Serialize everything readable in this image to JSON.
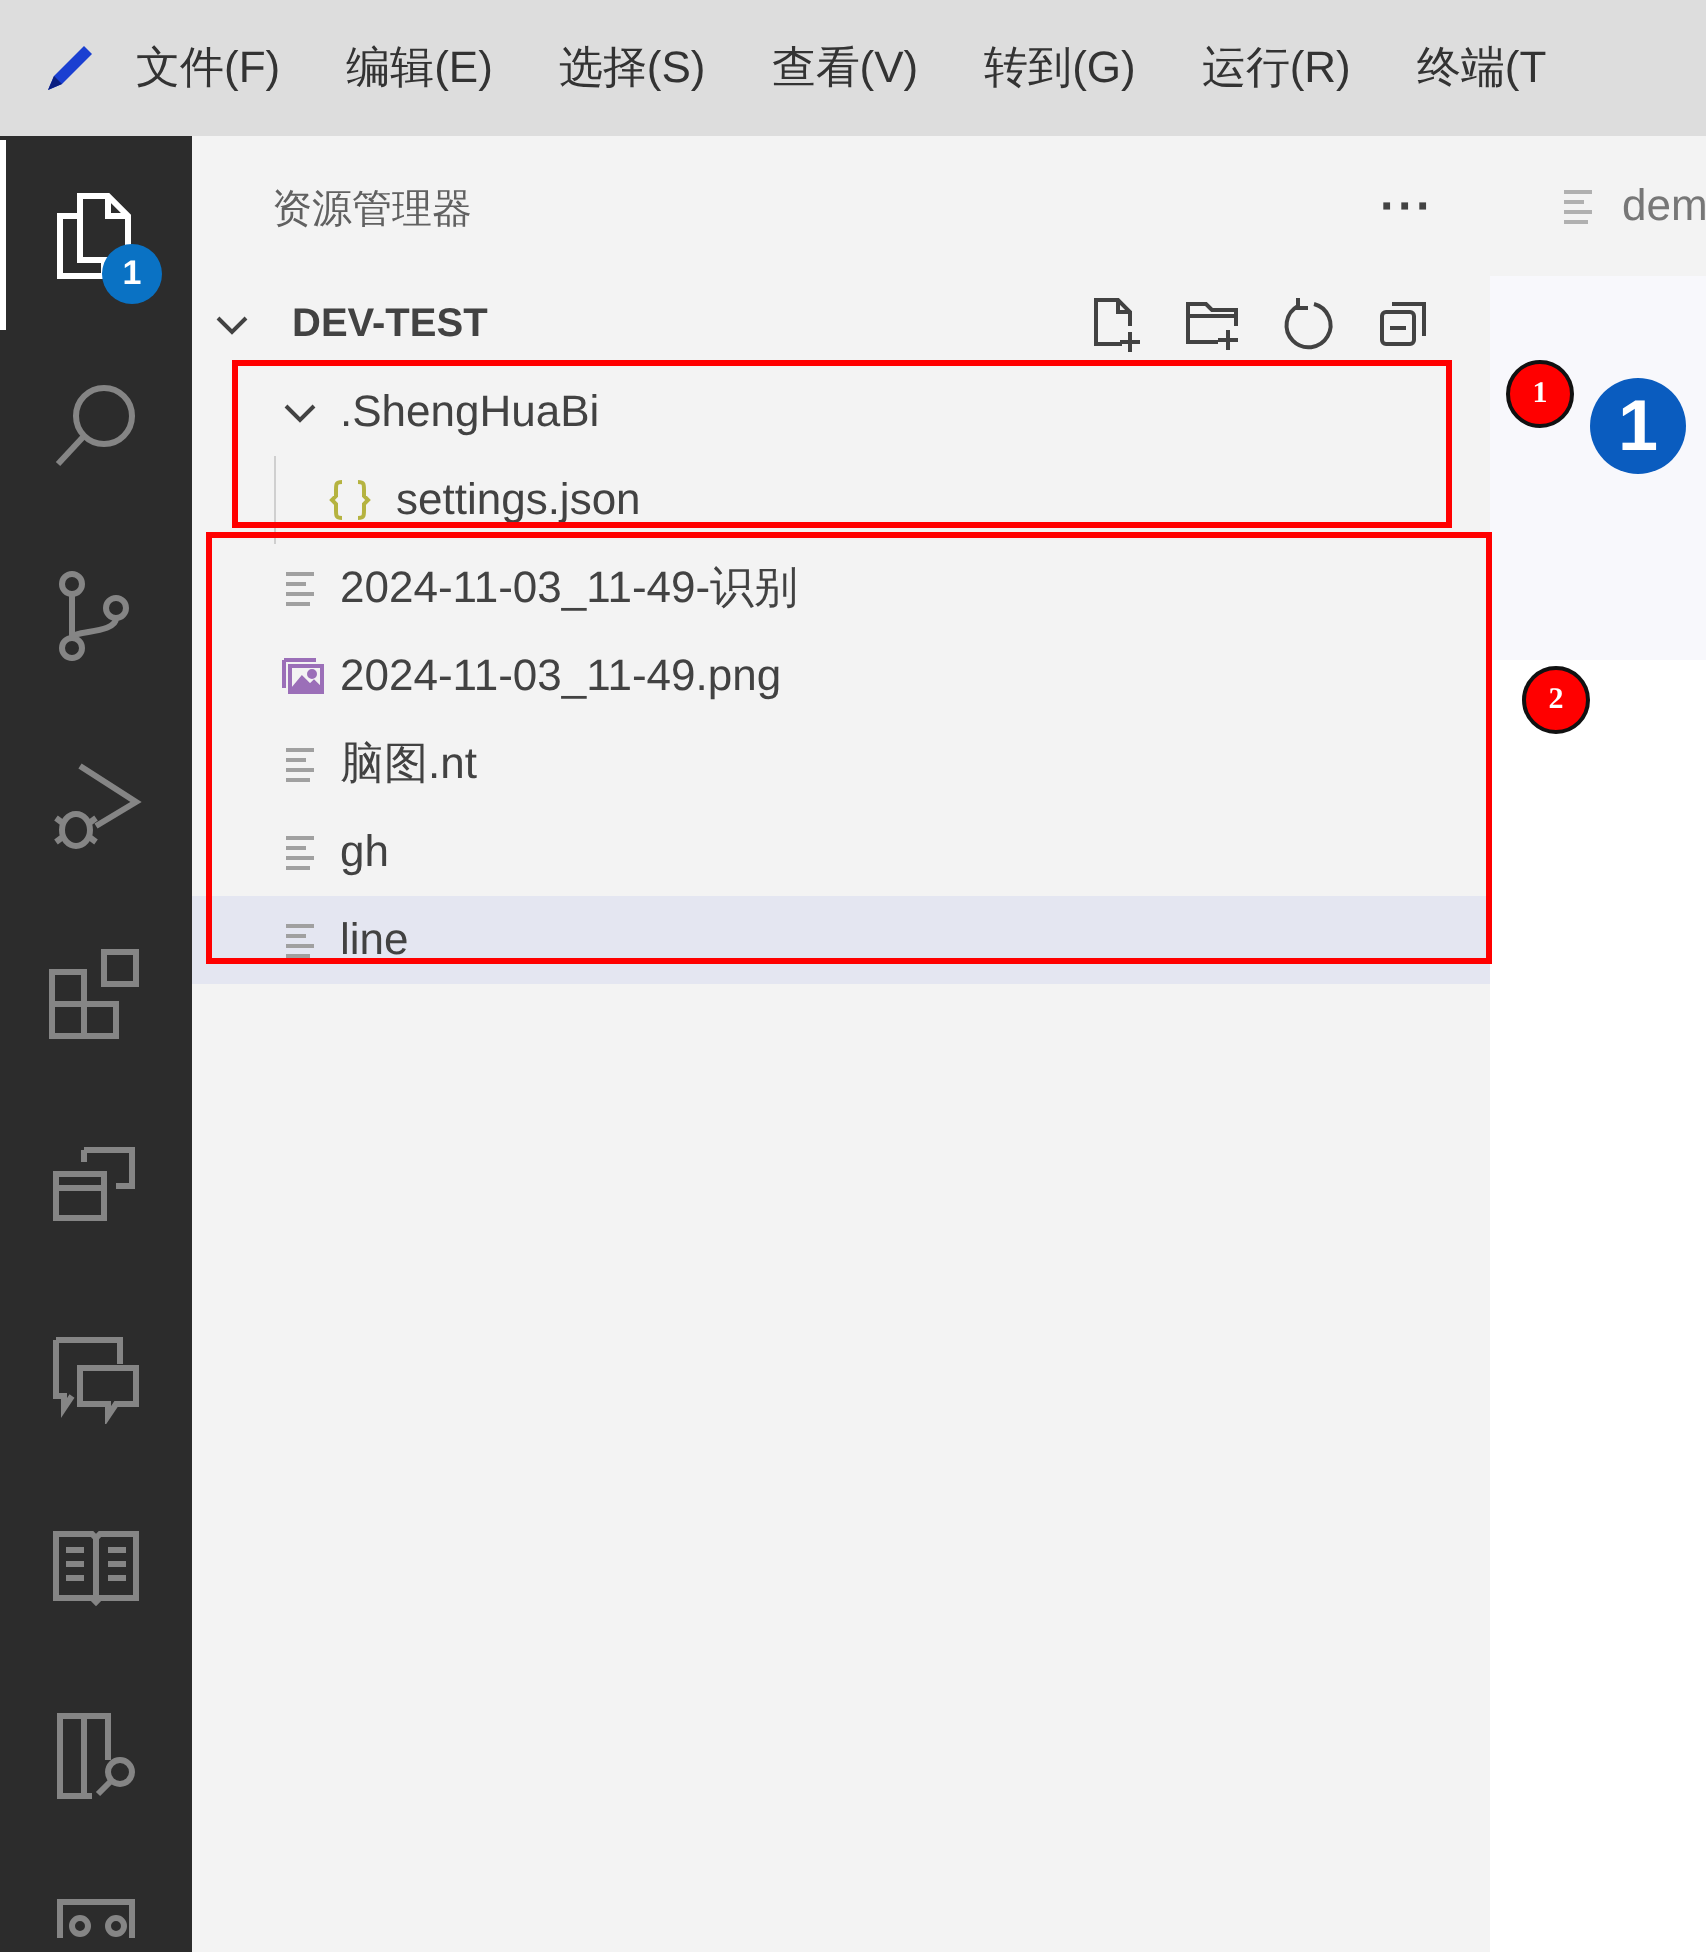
{
  "menu": [
    "文件(F)",
    "编辑(E)",
    "选择(S)",
    "查看(V)",
    "转到(G)",
    "运行(R)",
    "终端(T"
  ],
  "activity_bar": [
    {
      "kind": "files",
      "selected": true,
      "badge": "1"
    },
    {
      "kind": "search",
      "selected": false
    },
    {
      "kind": "source-control",
      "selected": false
    },
    {
      "kind": "run-debug",
      "selected": false
    },
    {
      "kind": "extensions",
      "selected": false
    },
    {
      "kind": "remote",
      "selected": false
    },
    {
      "kind": "chat",
      "selected": false
    },
    {
      "kind": "book",
      "selected": false
    },
    {
      "kind": "panel-search",
      "selected": false
    },
    {
      "kind": "cut",
      "selected": false
    }
  ],
  "sidebar": {
    "title": "资源管理器",
    "more": "···",
    "root": {
      "name": "DEV-TEST",
      "expanded": true,
      "children": [
        {
          "name": ".ShengHuaBi",
          "kind": "folder",
          "expanded": true,
          "selected": false,
          "children": [
            {
              "name": "settings.json",
              "kind": "json",
              "selected": false
            }
          ]
        },
        {
          "name": "2024-11-03_11-49-识别",
          "kind": "text",
          "selected": false
        },
        {
          "name": "2024-11-03_11-49.png",
          "kind": "image",
          "selected": false
        },
        {
          "name": "脑图.nt",
          "kind": "text",
          "selected": false
        },
        {
          "name": "gh",
          "kind": "text",
          "selected": false
        },
        {
          "name": "line",
          "kind": "text",
          "selected": true
        }
      ]
    }
  },
  "editor": {
    "tab": "dem"
  },
  "annotations": [
    {
      "kind": "red-dot",
      "label": "1"
    },
    {
      "kind": "blue-dot",
      "label": "1"
    },
    {
      "kind": "red-dot",
      "label": "2"
    }
  ]
}
